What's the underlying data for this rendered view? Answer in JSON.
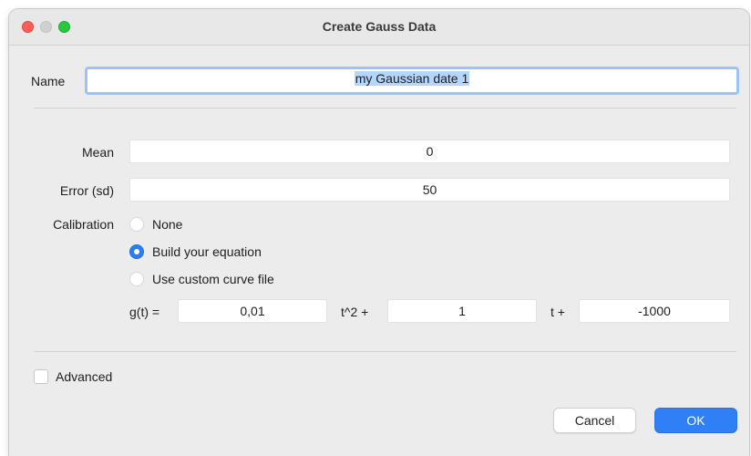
{
  "window": {
    "title": "Create Gauss Data"
  },
  "name": {
    "label": "Name",
    "value": "my Gaussian date 1"
  },
  "mean": {
    "label": "Mean",
    "value": "0"
  },
  "error": {
    "label": "Error (sd)",
    "value": "50"
  },
  "calibration": {
    "label": "Calibration",
    "options": [
      {
        "label": "None",
        "selected": false
      },
      {
        "label": "Build your equation",
        "selected": true
      },
      {
        "label": "Use custom curve file",
        "selected": false
      }
    ]
  },
  "equation": {
    "prefix": "g(t) =",
    "coef_a": "0,01",
    "term_a": "t^2 +",
    "coef_b": "1",
    "term_b": "t +",
    "coef_c": "-1000"
  },
  "advanced": {
    "label": "Advanced",
    "checked": false
  },
  "buttons": {
    "cancel": "Cancel",
    "ok": "OK"
  },
  "colors": {
    "accent": "#2f80f7",
    "focus_ring": "#9cc3f5",
    "close": "#ff5f57",
    "maximize": "#28c840"
  }
}
